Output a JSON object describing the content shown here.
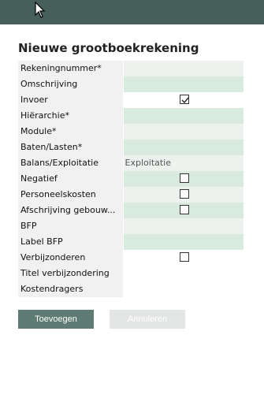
{
  "form": {
    "title": "Nieuwe grootboekrekening",
    "rows": [
      {
        "label": "Rekeningnummer*",
        "value": ""
      },
      {
        "label": "Omschrijving",
        "value": ""
      },
      {
        "label": "Invoer",
        "value": "",
        "checked": true
      },
      {
        "label": "Hiërarchie*",
        "value": ""
      },
      {
        "label": "Module*",
        "value": ""
      },
      {
        "label": "Baten/Lasten*",
        "value": ""
      },
      {
        "label": "Balans/Exploitatie",
        "value": "Exploitatie"
      },
      {
        "label": "Negatief",
        "value": "",
        "checked": false
      },
      {
        "label": "Personeelskosten",
        "value": "",
        "checked": false
      },
      {
        "label": "Afschrijving gebouw...",
        "value": "",
        "checked": false
      },
      {
        "label": "BFP",
        "value": ""
      },
      {
        "label": "Label BFP",
        "value": ""
      },
      {
        "label": "Verbijzonderen",
        "value": "",
        "checked": false
      },
      {
        "label": "Titel verbijzondering",
        "value": ""
      },
      {
        "label": "Kostendragers",
        "value": ""
      }
    ]
  },
  "buttons": {
    "add_label": "Toevoegen",
    "cancel_label": "Annuleren"
  },
  "colors": {
    "topbar": "#475f5a",
    "field_green": "#d9eadf",
    "button_primary": "#5e7c74",
    "button_disabled": "#e3e6e5"
  }
}
